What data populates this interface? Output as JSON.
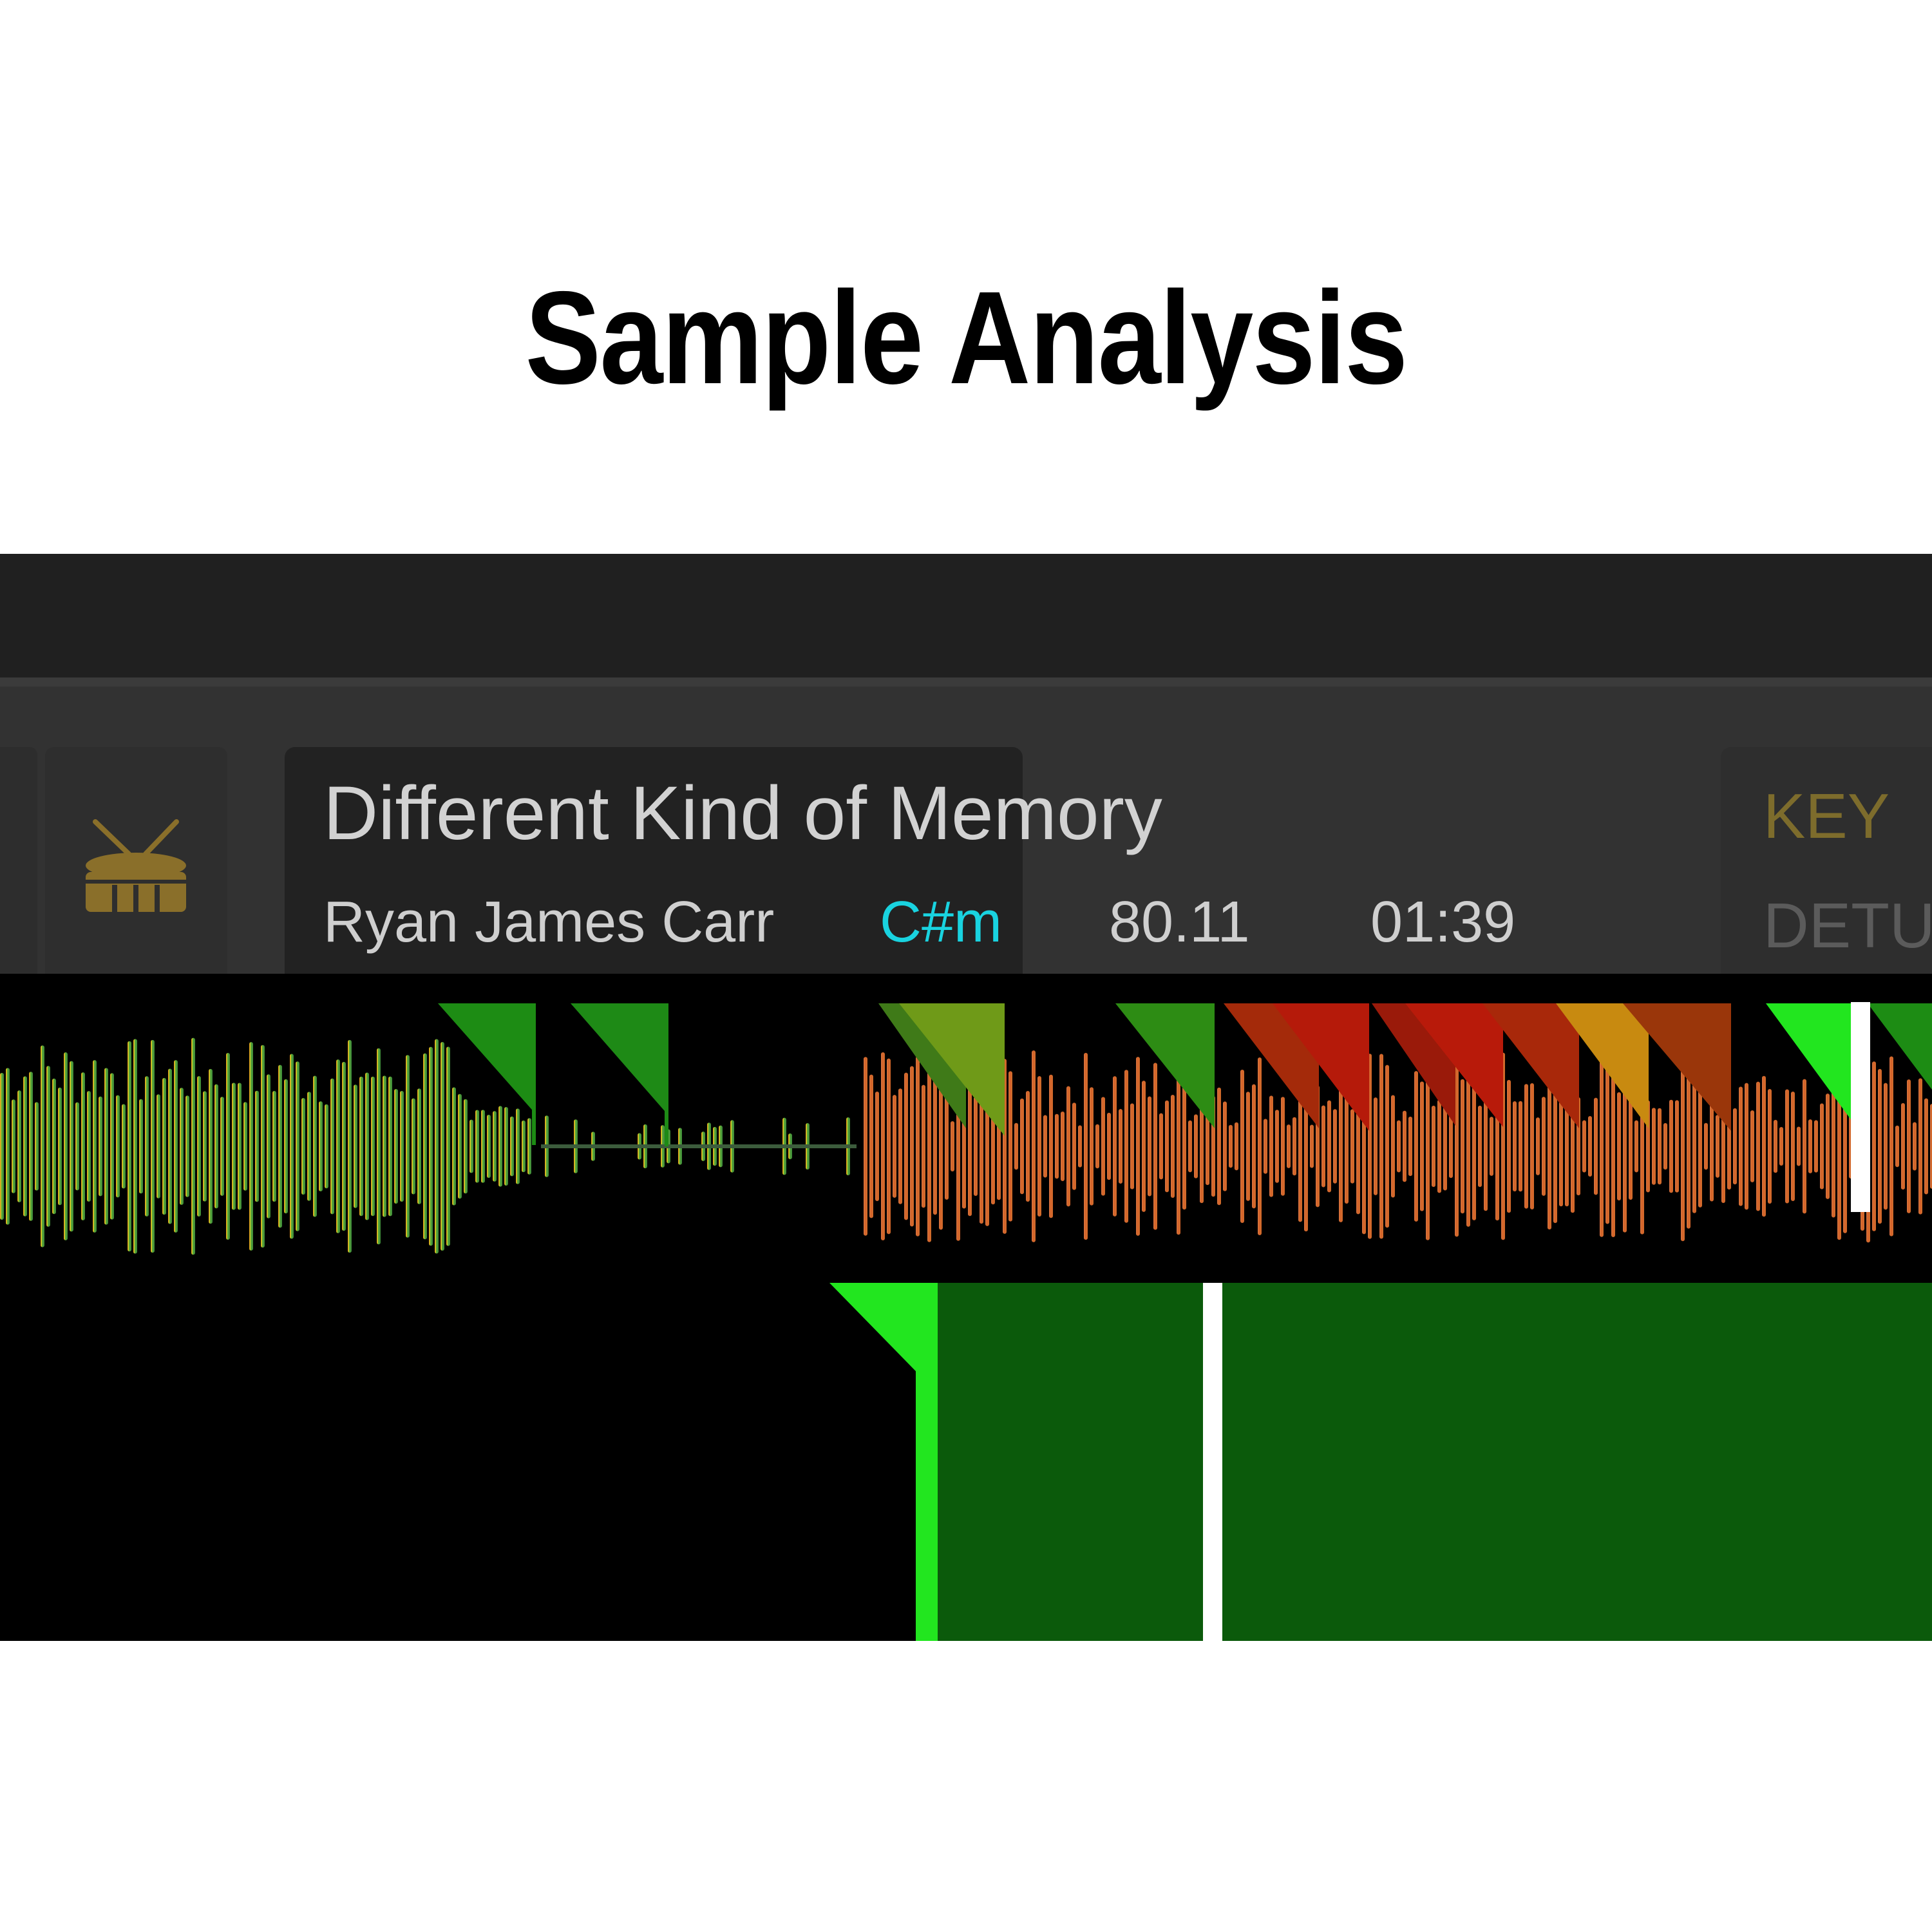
{
  "headline": "Sample Analysis",
  "track": {
    "title": "Different Kind of Memory",
    "artist": "Ryan James Carr",
    "key": "C#m",
    "bpm": "80.11",
    "duration": "01:39"
  },
  "side_panel": {
    "key_label": "KEY",
    "detune_label": "DETU"
  },
  "icons": {
    "sample_type": "drum-icon"
  },
  "colors": {
    "page_background": "#ffffff",
    "headline": "#000000",
    "top_bar": "#202020",
    "deck_strip": "#323232",
    "track_panel": "#222222",
    "title_text": "#d2d2d2",
    "key_text": "#19d3e0",
    "drum_icon": "#8a6f2a",
    "key_label": "#7d6c2c",
    "detune_label": "#5b5b5b",
    "cue_green": "#1d8c14",
    "cue_bright_green": "#22e61f",
    "cue_red": "#b51a0a",
    "loop_region": "#0b5a0b",
    "playhead": "#ffffff"
  }
}
